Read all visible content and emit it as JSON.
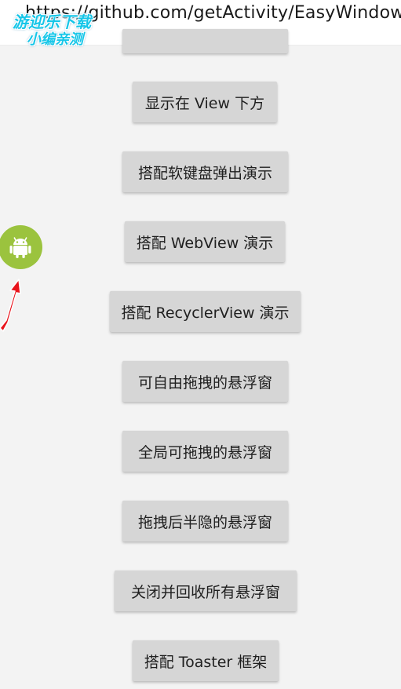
{
  "url_bar": {
    "url": "https://github.com/getActivity/EasyWindow"
  },
  "watermark": {
    "line1": "游迎乐下载",
    "line2": "小编亲测"
  },
  "buttons": [
    {
      "label": ""
    },
    {
      "label": "显示在 View 下方"
    },
    {
      "label": "搭配软键盘弹出演示"
    },
    {
      "label": "搭配 WebView 演示"
    },
    {
      "label": "搭配 RecyclerView 演示"
    },
    {
      "label": "可自由拖拽的悬浮窗"
    },
    {
      "label": "全局可拖拽的悬浮窗"
    },
    {
      "label": "拖拽后半隐的悬浮窗"
    },
    {
      "label": "关闭并回收所有悬浮窗"
    },
    {
      "label": "搭配 Toaster 框架"
    }
  ],
  "floating_window": {
    "icon": "android-icon",
    "color": "#9bc33e"
  },
  "annotation": {
    "icon": "red-arrow-icon",
    "color": "#e8141c"
  }
}
